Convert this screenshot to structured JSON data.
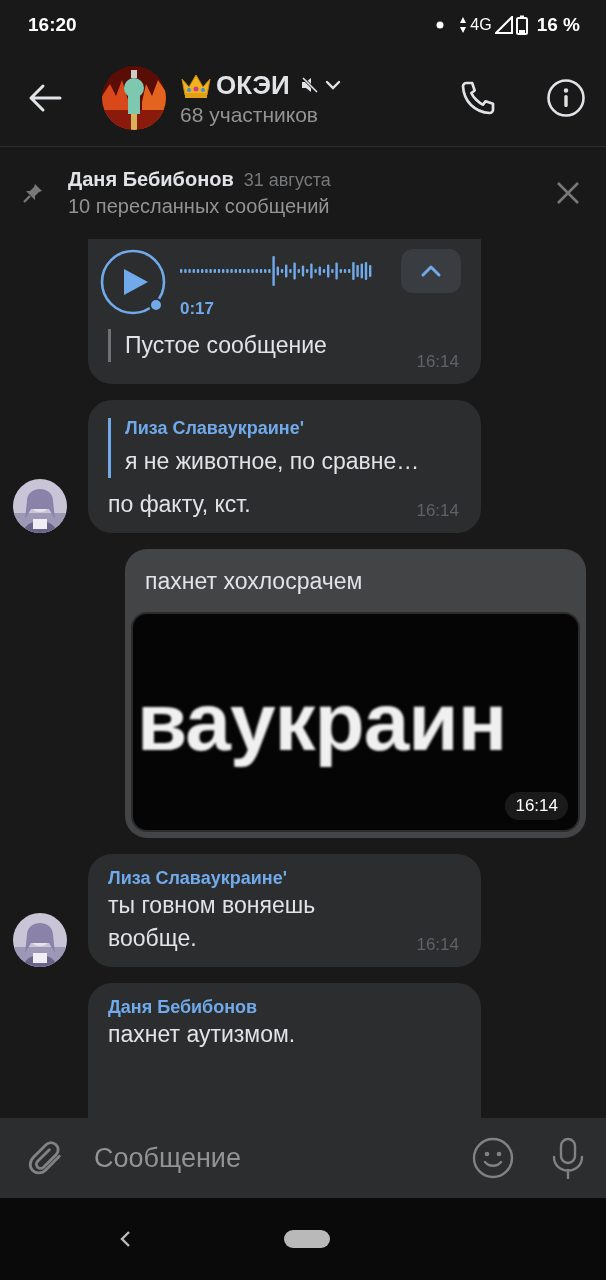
{
  "status_bar": {
    "time": "16:20",
    "network": "4G",
    "battery": "16 %"
  },
  "header": {
    "title": "ОКЭИ",
    "muted": true,
    "subtitle": "68 участников"
  },
  "pinned": {
    "author": "Даня Бебибонов",
    "date": "31 августа",
    "text": "10 пересланных сообщений"
  },
  "messages": [
    {
      "kind": "voice",
      "duration": "0:17",
      "text": "Пустое сообщение",
      "time": "16:14",
      "outgoing": false,
      "avatar": false
    },
    {
      "kind": "reply",
      "reply_author": "Лиза Славаукраине'",
      "reply_text": "я не животное, по сравне…",
      "text": "по факту, кст.",
      "time": "16:14",
      "outgoing": false,
      "avatar": true
    },
    {
      "text": "пахнет хохлосрачем",
      "image_text": "ваукраин",
      "time": "16:14",
      "outgoing": true
    },
    {
      "kind": "text",
      "author": "Лиза Славаукраине'",
      "text": "ты говном воняешь вообще.",
      "time": "16:14",
      "outgoing": false,
      "avatar": true
    },
    {
      "kind": "text",
      "author": "Даня Бебибонов",
      "text": "пахнет аутизмом.",
      "outgoing": false,
      "avatar": false
    }
  ],
  "composer": {
    "placeholder": "Сообщение"
  }
}
